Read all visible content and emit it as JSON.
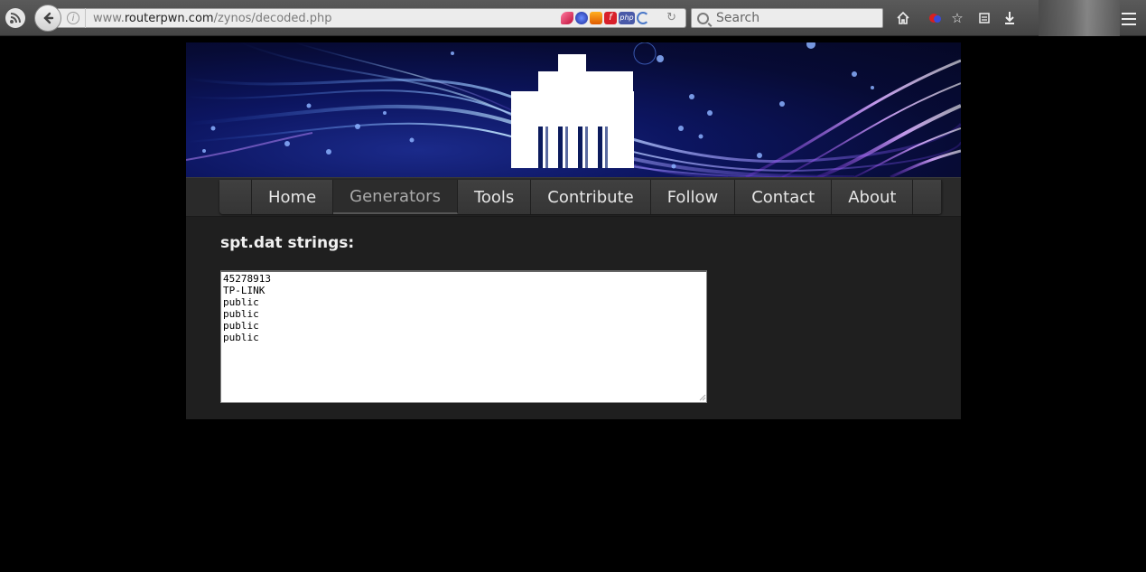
{
  "browser": {
    "url_prefix": "www.",
    "url_domain": "routerpwn.com",
    "url_path": "/zynos/decoded.php",
    "search_placeholder": "Search",
    "addon_php_label": "php"
  },
  "nav": {
    "items": [
      {
        "label": "Home"
      },
      {
        "label": "Generators"
      },
      {
        "label": "Tools"
      },
      {
        "label": "Contribute"
      },
      {
        "label": "Follow"
      },
      {
        "label": "Contact"
      },
      {
        "label": "About"
      }
    ]
  },
  "content": {
    "heading": "spt.dat strings:",
    "strings": "45278913\nTP-LINK\npublic\npublic\npublic\npublic"
  },
  "colors": {
    "page_bg": "#000000",
    "content_bg": "#1f1f1f",
    "navbar_bg": "#2a2a2a",
    "banner_dark": "#070b35"
  }
}
